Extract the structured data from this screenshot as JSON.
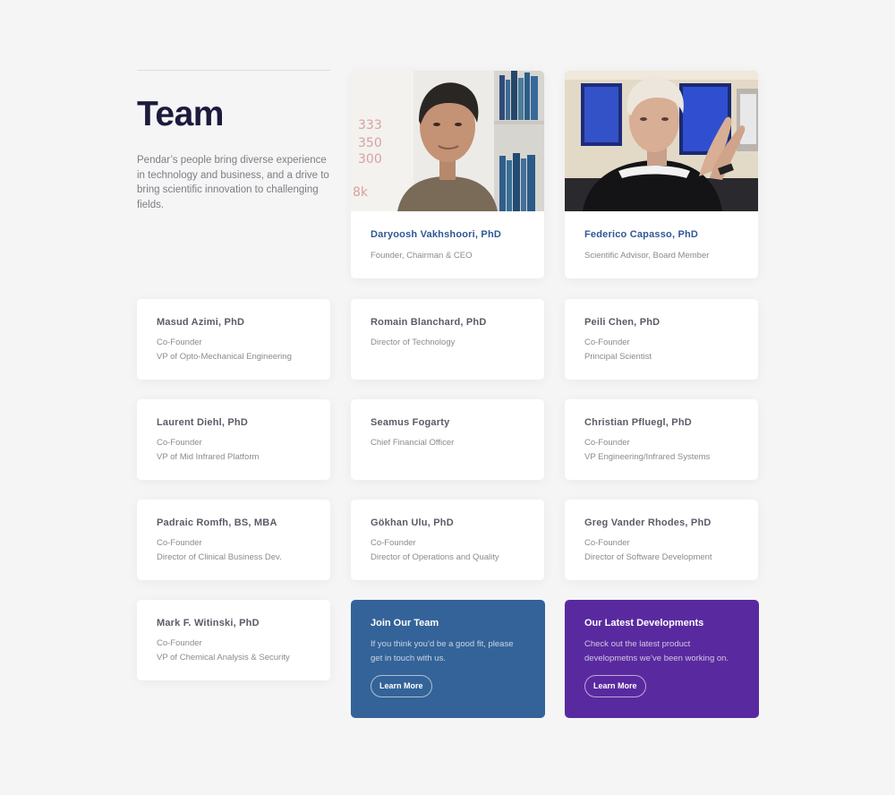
{
  "intro": {
    "title": "Team",
    "description": "Pendar’s people bring diverse experience in technology and business, and a drive to bring scientific innovation to challenging fields."
  },
  "featured": [
    {
      "name": "Daryoosh Vakhshoori, PhD",
      "roles": [
        "Founder, Chairman & CEO"
      ]
    },
    {
      "name": "Federico Capasso, PhD",
      "roles": [
        "Scientific Advisor, Board Member"
      ]
    }
  ],
  "members": [
    {
      "name": "Masud Azimi, PhD",
      "roles": [
        "Co-Founder",
        "VP of Opto-Mechanical Engineering"
      ]
    },
    {
      "name": "Romain Blanchard, PhD",
      "roles": [
        "Director of Technology"
      ]
    },
    {
      "name": "Peili Chen, PhD",
      "roles": [
        "Co-Founder",
        "Principal Scientist"
      ]
    },
    {
      "name": "Laurent Diehl, PhD",
      "roles": [
        "Co-Founder",
        "VP of Mid Infrared Platform"
      ]
    },
    {
      "name": "Seamus Fogarty",
      "roles": [
        "Chief Financial Officer"
      ]
    },
    {
      "name": "Christian Pfluegl, PhD",
      "roles": [
        "Co-Founder",
        "VP Engineering/Infrared Systems"
      ]
    },
    {
      "name": "Padraic Romfh, BS, MBA",
      "roles": [
        "Co-Founder",
        "Director of Clinical Business Dev."
      ]
    },
    {
      "name": "Gökhan Ulu, PhD",
      "roles": [
        "Co-Founder",
        "Director of Operations and Quality"
      ]
    },
    {
      "name": "Greg Vander Rhodes, PhD",
      "roles": [
        "Co-Founder",
        "Director of Software Development"
      ]
    },
    {
      "name": "Mark F. Witinski, PhD",
      "roles": [
        "Co-Founder",
        "VP of Chemical Analysis & Security"
      ]
    }
  ],
  "cta": {
    "join": {
      "title": "Join Our Team",
      "text": "If you think you’d be a good fit, please get in touch with us.",
      "button": "Learn More",
      "color": "#346399"
    },
    "developments": {
      "title": "Our Latest Developments",
      "text": "Check out the latest product developmetns we’ve been working on.",
      "button": "Learn More",
      "color": "#592a9f"
    }
  },
  "colors": {
    "background": "#f5f5f5",
    "title": "#1c1a3d",
    "featured_name": "#2f5893"
  }
}
